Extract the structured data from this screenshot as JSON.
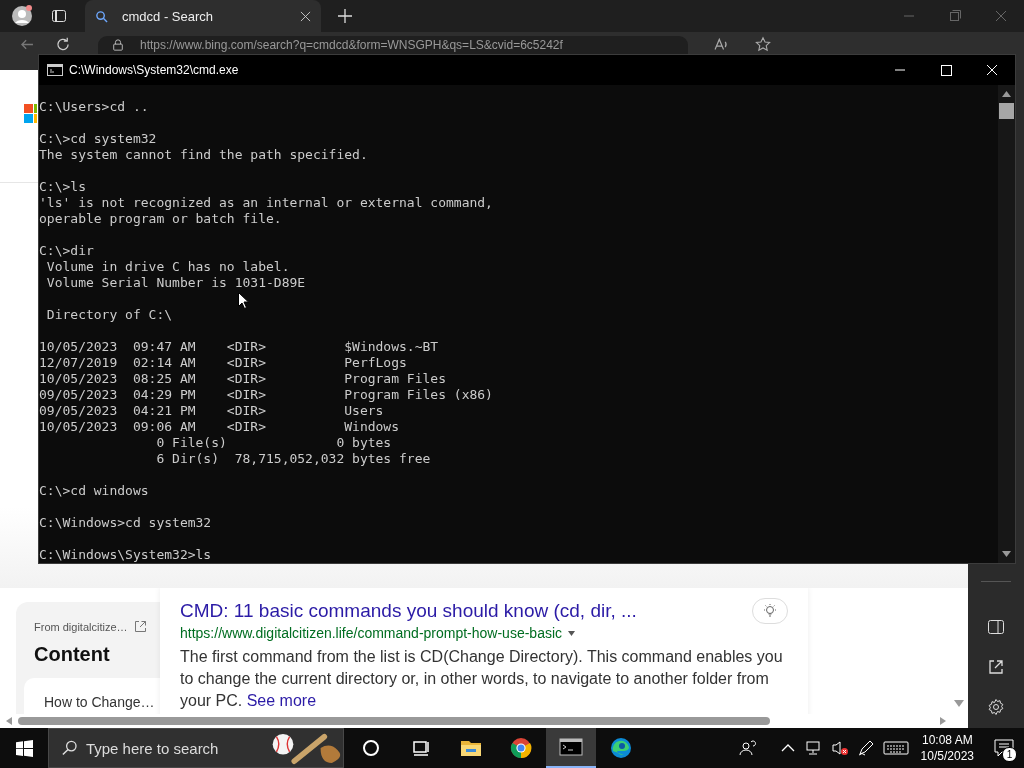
{
  "browser": {
    "tabs": [
      {
        "title": "cmdcd - Search",
        "selected": true
      }
    ],
    "address": "https://www.bing.com/search?q=cmdcd&form=WNSGPH&qs=LS&cvid=6c5242f",
    "side_panel": {
      "source": "From digitalcitize…",
      "heading": "Content",
      "items": [
        "How to Change…"
      ]
    },
    "result": {
      "title": "CMD: 11 basic commands you should know (cd, dir, ...",
      "url": "https://www.digitalcitizen.life/command-prompt-how-use-basic",
      "snippet": "The first command from the list is CD(Change Directory). This command enables you to change the current directory or, in other words, to navigate to another folder from your PC.",
      "more_link": "See more"
    }
  },
  "console": {
    "title": "C:\\Windows\\System32\\cmd.exe",
    "blocks": [
      [
        "C:\\Users>cd .."
      ],
      [
        "C:\\>cd system32",
        "The system cannot find the path specified."
      ],
      [
        "C:\\>ls",
        "'ls' is not recognized as an internal or external command,",
        "operable program or batch file."
      ],
      [
        "C:\\>dir",
        " Volume in drive C has no label.",
        " Volume Serial Number is 1031-D89E"
      ],
      [
        " Directory of C:\\"
      ],
      [
        "10/05/2023  09:47 AM    <DIR>          $Windows.~BT",
        "12/07/2019  02:14 AM    <DIR>          PerfLogs",
        "10/05/2023  08:25 AM    <DIR>          Program Files",
        "09/05/2023  04:29 PM    <DIR>          Program Files (x86)",
        "09/05/2023  04:21 PM    <DIR>          Users",
        "10/05/2023  09:06 AM    <DIR>          Windows",
        "               0 File(s)              0 bytes",
        "               6 Dir(s)  78,715,052,032 bytes free"
      ],
      [
        "C:\\>cd windows"
      ],
      [
        "C:\\Windows>cd system32"
      ],
      [
        "C:\\Windows\\System32>ls"
      ]
    ]
  },
  "taskbar": {
    "search_placeholder": "Type here to search",
    "apps": [
      {
        "kind": "cortana",
        "selected": false
      },
      {
        "kind": "taskview",
        "selected": false
      },
      {
        "kind": "explorer",
        "selected": false
      },
      {
        "kind": "chrome",
        "selected": false
      },
      {
        "kind": "terminal",
        "selected": true
      },
      {
        "kind": "edge",
        "selected": false
      }
    ],
    "time": "10:08 AM",
    "date": "10/5/2023",
    "notification_count": "1"
  }
}
